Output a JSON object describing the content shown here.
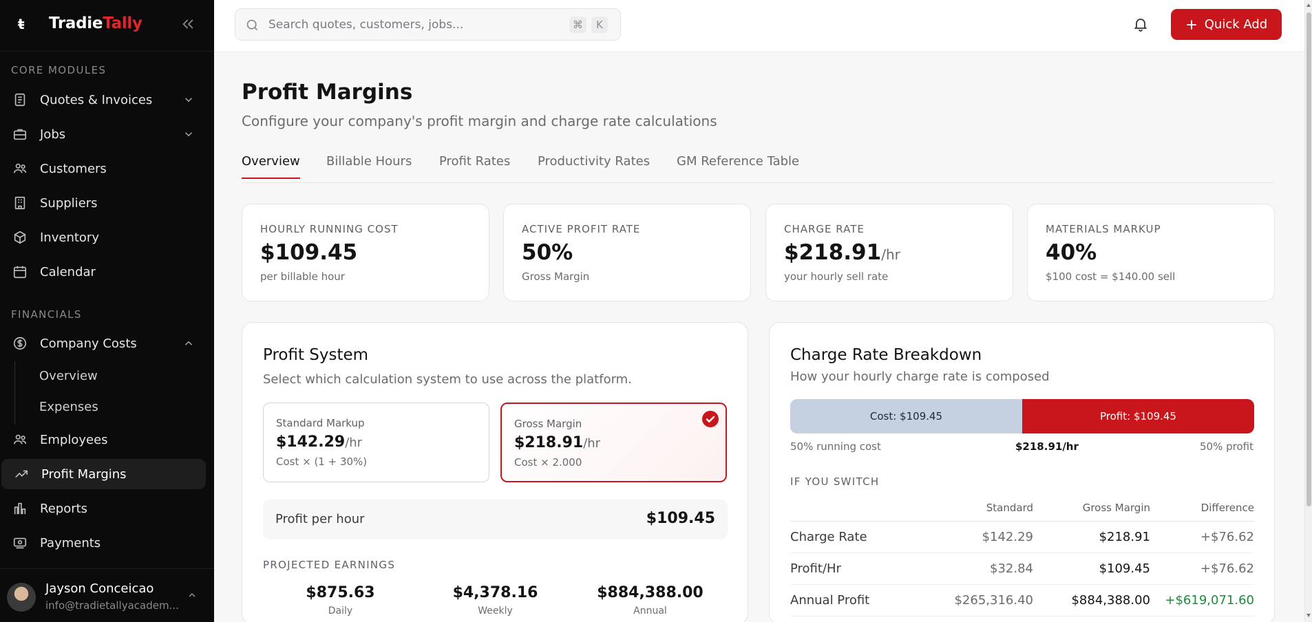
{
  "brand": {
    "logo_glyph": "ŧ",
    "name_part1": "Tradie",
    "name_part2": "Tally"
  },
  "sidebar": {
    "section_core": "CORE MODULES",
    "section_financials": "FINANCIALS",
    "items": [
      {
        "label": "Quotes & Invoices",
        "icon": "receipt-icon",
        "expandable": true
      },
      {
        "label": "Jobs",
        "icon": "briefcase-icon",
        "expandable": true
      },
      {
        "label": "Customers",
        "icon": "users-icon"
      },
      {
        "label": "Suppliers",
        "icon": "building-icon"
      },
      {
        "label": "Inventory",
        "icon": "package-icon"
      },
      {
        "label": "Calendar",
        "icon": "calendar-icon"
      },
      {
        "label": "Company Costs",
        "icon": "dollar-icon",
        "expanded": true
      },
      {
        "label": "Employees",
        "icon": "users-icon"
      },
      {
        "label": "Profit Margins",
        "icon": "trending-up-icon",
        "active": true
      },
      {
        "label": "Reports",
        "icon": "bar-chart-icon"
      },
      {
        "label": "Payments",
        "icon": "payments-icon"
      }
    ],
    "sub_items": [
      "Overview",
      "Expenses"
    ]
  },
  "user": {
    "name": "Jayson Conceicao",
    "email": "info@tradietallyacadem..."
  },
  "topbar": {
    "search_placeholder": "Search quotes, customers, jobs...",
    "shortcut_cmd": "⌘",
    "shortcut_key": "K",
    "quick_add": "Quick Add"
  },
  "page": {
    "title": "Profit Margins",
    "subtitle": "Configure your company's profit margin and charge rate calculations"
  },
  "tabs": [
    "Overview",
    "Billable Hours",
    "Profit Rates",
    "Productivity Rates",
    "GM Reference Table"
  ],
  "active_tab": "Overview",
  "stats": [
    {
      "caption": "HOURLY RUNNING COST",
      "value": "$109.45",
      "unit": "",
      "note": "per billable hour"
    },
    {
      "caption": "ACTIVE PROFIT RATE",
      "value": "50%",
      "unit": "",
      "note": "Gross Margin"
    },
    {
      "caption": "CHARGE RATE",
      "value": "$218.91",
      "unit": "/hr",
      "note": "your hourly sell rate"
    },
    {
      "caption": "MATERIALS MARKUP",
      "value": "40%",
      "unit": "",
      "note": "$100 cost = $140.00 sell"
    }
  ],
  "profit_system": {
    "title": "Profit System",
    "subtitle": "Select which calculation system to use across the platform.",
    "options": [
      {
        "name": "Standard Markup",
        "value": "$142.29",
        "unit": "/hr",
        "formula": "Cost × (1 + 30%)",
        "selected": false
      },
      {
        "name": "Gross Margin",
        "value": "$218.91",
        "unit": "/hr",
        "formula": "Cost × 2.000",
        "selected": true
      }
    ],
    "profit_per_hour_label": "Profit per hour",
    "profit_per_hour_value": "$109.45",
    "projected_label": "PROJECTED EARNINGS",
    "projected": [
      {
        "value": "$875.63",
        "caption": "Daily"
      },
      {
        "value": "$4,378.16",
        "caption": "Weekly"
      },
      {
        "value": "$884,388.00",
        "caption": "Annual"
      }
    ]
  },
  "breakdown": {
    "title": "Charge Rate Breakdown",
    "subtitle": "How your hourly charge rate is composed",
    "cost_label": "Cost: $109.45",
    "profit_label": "Profit: $109.45",
    "cost_share": 0.5,
    "profit_share": 0.5,
    "legend_left": "50% running cost",
    "legend_mid": "$218.91/hr",
    "legend_right": "50% profit",
    "switch_label": "IF YOU SWITCH",
    "columns": [
      "",
      "Standard",
      "Gross Margin",
      "Difference"
    ],
    "rows": [
      {
        "label": "Charge Rate",
        "standard": "$142.29",
        "gm": "$218.91",
        "diff": "+$76.62",
        "diff_positive_green": false
      },
      {
        "label": "Profit/Hr",
        "standard": "$32.84",
        "gm": "$109.45",
        "diff": "+$76.62",
        "diff_positive_green": false
      },
      {
        "label": "Annual Profit",
        "standard": "$265,316.40",
        "gm": "$884,388.00",
        "diff": "+$619,071.60",
        "diff_positive_green": true
      }
    ]
  },
  "colors": {
    "accent": "#c8161c",
    "sidebar_bg": "#0b0b0b",
    "cost_segment": "#c5d0e0",
    "positive": "#1f8a3a"
  }
}
